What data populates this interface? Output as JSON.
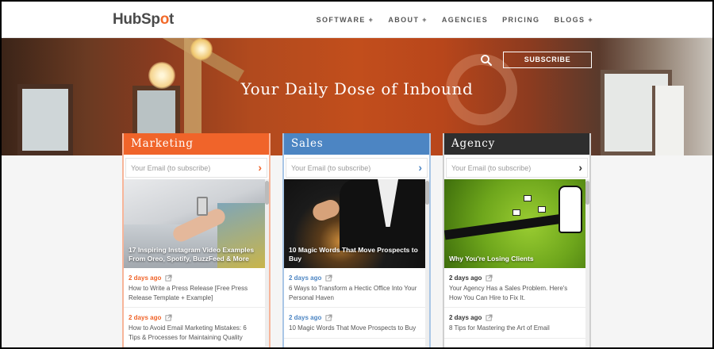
{
  "header": {
    "logo_prefix": "HubSp",
    "logo_spot": "o",
    "logo_suffix": "t",
    "nav": [
      {
        "label": "SOFTWARE +"
      },
      {
        "label": "ABOUT +"
      },
      {
        "label": "AGENCIES"
      },
      {
        "label": "PRICING"
      },
      {
        "label": "BLOGS +"
      }
    ]
  },
  "hero": {
    "title": "Your Daily Dose of Inbound",
    "subscribe_label": "SUBSCRIBE",
    "search_icon": "search-icon"
  },
  "colors": {
    "marketing": "#f0642a",
    "sales": "#4c85c3",
    "agency": "#2e2e2e"
  },
  "columns": {
    "marketing": {
      "title": "Marketing",
      "email_placeholder": "Your Email (to subscribe)",
      "feature_caption": "17 Inspiring Instagram Video Examples From Oreo, Spotify, BuzzFeed & More",
      "posts": [
        {
          "date": "2 days ago",
          "title": "How to Write a Press Release [Free Press Release Template + Example]"
        },
        {
          "date": "2 days ago",
          "title": "How to Avoid Email Marketing Mistakes: 6 Tips & Processes for Maintaining Quality"
        }
      ]
    },
    "sales": {
      "title": "Sales",
      "email_placeholder": "Your Email (to subscribe)",
      "feature_caption": "10 Magic Words That Move Prospects to Buy",
      "posts": [
        {
          "date": "2 days ago",
          "title": "6 Ways to Transform a Hectic Office Into Your Personal Haven"
        },
        {
          "date": "2 days ago",
          "title": "10 Magic Words That Move Prospects to Buy"
        }
      ]
    },
    "agency": {
      "title": "Agency",
      "email_placeholder": "Your Email (to subscribe)",
      "feature_caption": "Why You're Losing Clients",
      "posts": [
        {
          "date": "2 days ago",
          "title": "Your Agency Has a Sales Problem. Here's How You Can Hire to Fix It."
        },
        {
          "date": "2 days ago",
          "title": "8 Tips for Mastering the Art of Email"
        }
      ]
    }
  }
}
